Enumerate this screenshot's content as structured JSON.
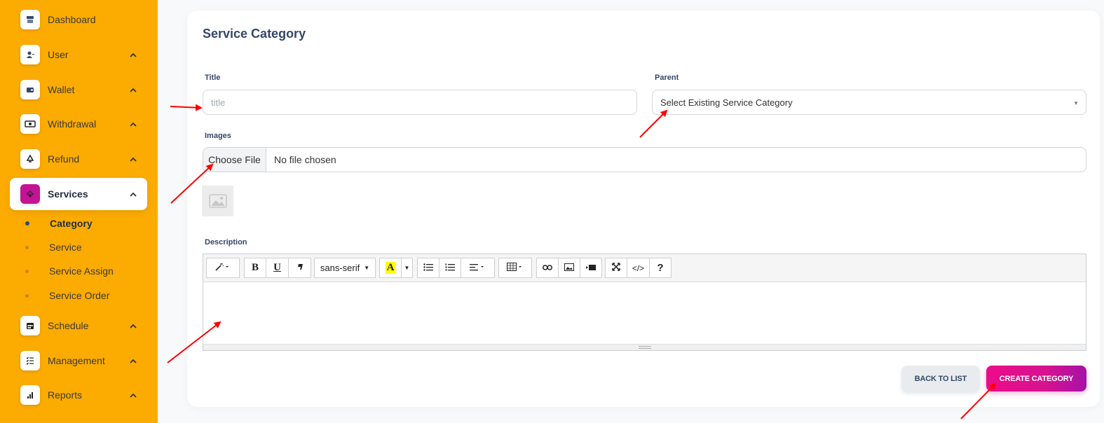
{
  "sidebar": {
    "items": [
      {
        "label": "Dashboard",
        "icon": "store-icon"
      },
      {
        "label": "User",
        "icon": "user-add-icon"
      },
      {
        "label": "Wallet",
        "icon": "wallet-icon"
      },
      {
        "label": "Withdrawal",
        "icon": "money-icon"
      },
      {
        "label": "Refund",
        "icon": "recycle-icon"
      },
      {
        "label": "Services",
        "icon": "layers-icon"
      },
      {
        "label": "Schedule",
        "icon": "calendar-icon"
      },
      {
        "label": "Management",
        "icon": "checklist-icon"
      },
      {
        "label": "Reports",
        "icon": "bar-chart-icon"
      }
    ],
    "services_sub": [
      "Category",
      "Service",
      "Service Assign",
      "Service Order"
    ],
    "active_item": "Services",
    "active_sub": "Category"
  },
  "main": {
    "title": "Service Category",
    "title_label": "Title",
    "title_placeholder": "title",
    "parent_label": "Parent",
    "parent_selected": "Select Existing Service Category",
    "images_label": "Images",
    "file_button": "Choose File",
    "file_status": "No file chosen",
    "description_label": "Description",
    "editor": {
      "font_name": "sans-serif",
      "bold": "B",
      "underline": "U",
      "help": "?",
      "code": "</>",
      "color_letter": "A"
    },
    "back_button": "BACK TO LIST",
    "create_button": "CREATE CATEGORY"
  },
  "colors": {
    "sidebar_bg": "#fcab00",
    "accent": "#c41395",
    "arrow": "#ff0000"
  }
}
